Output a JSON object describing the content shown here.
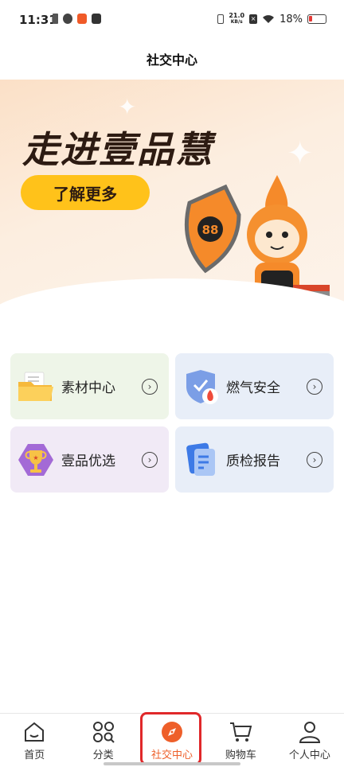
{
  "status_bar": {
    "time": "11:31",
    "net_speed_value": "21.0",
    "net_speed_unit": "KB/s",
    "battery": "18%"
  },
  "header": {
    "title": "社交中心"
  },
  "banner": {
    "headline": "走进壹品慧",
    "button_label": "了解更多"
  },
  "cards": [
    {
      "label": "素材中心",
      "icon": "folder-icon"
    },
    {
      "label": "燃气安全",
      "icon": "shield-fire-icon"
    },
    {
      "label": "壹品优选",
      "icon": "trophy-icon"
    },
    {
      "label": "质检报告",
      "icon": "report-icon"
    }
  ],
  "tabbar": {
    "items": [
      {
        "label": "首页",
        "icon": "home-icon"
      },
      {
        "label": "分类",
        "icon": "category-icon"
      },
      {
        "label": "社交中心",
        "icon": "compass-icon",
        "active": true
      },
      {
        "label": "购物车",
        "icon": "cart-icon"
      },
      {
        "label": "个人中心",
        "icon": "person-icon"
      }
    ],
    "active_color": "#ee5f2a"
  }
}
